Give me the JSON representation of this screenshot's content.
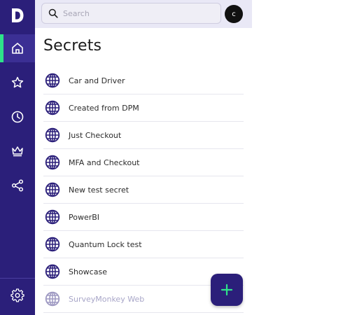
{
  "app": {
    "logo_letter": "D"
  },
  "search": {
    "placeholder": "Search"
  },
  "user": {
    "avatar_initial": "c"
  },
  "page": {
    "title": "Secrets"
  },
  "sidebar": {
    "items": [
      {
        "name": "home",
        "icon": "home-icon",
        "active": true
      },
      {
        "name": "favorites",
        "icon": "star-icon",
        "active": false
      },
      {
        "name": "recent",
        "icon": "clock-icon",
        "active": false
      },
      {
        "name": "premium",
        "icon": "crown-icon",
        "active": false
      },
      {
        "name": "shared",
        "icon": "share-icon",
        "active": false
      }
    ],
    "settings_icon": "gear-icon"
  },
  "secrets": [
    {
      "label": "Car and Driver"
    },
    {
      "label": "Created from DPM"
    },
    {
      "label": "Just Checkout"
    },
    {
      "label": "MFA and Checkout"
    },
    {
      "label": "New test secret"
    },
    {
      "label": "PowerBI"
    },
    {
      "label": "Quantum Lock test"
    },
    {
      "label": "Showcase"
    },
    {
      "label": "SurveyMonkey Web"
    }
  ],
  "colors": {
    "sidebar": "#2b1f7a",
    "accent": "#2ee38a",
    "icon": "#2b1f7a",
    "topbar": "#e9e8f6"
  }
}
